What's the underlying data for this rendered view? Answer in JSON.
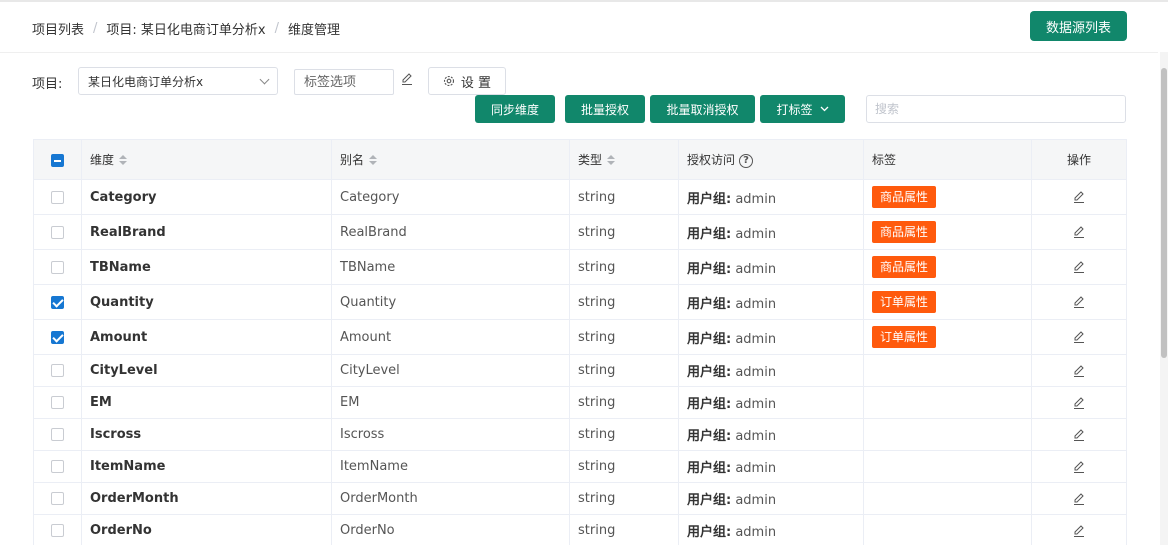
{
  "breadcrumb": {
    "items": [
      "项目列表",
      "项目: 某日化电商订单分析x",
      "维度管理"
    ],
    "separator": "/"
  },
  "header": {
    "datasource_button": "数据源列表"
  },
  "filters": {
    "project_label": "项目:",
    "project_value": "某日化电商订单分析x",
    "tag_placeholder": "标签选项",
    "settings_label": "设 置"
  },
  "toolbar": {
    "sync": "同步维度",
    "batch_grant": "批量授权",
    "batch_revoke": "批量取消授权",
    "tag": "打标签",
    "search_placeholder": "搜索"
  },
  "colors": {
    "primary": "#11876b",
    "tag": "#ff5a0d",
    "checkbox": "#1677d2"
  },
  "table": {
    "columns": {
      "dimension": "维度",
      "alias": "别名",
      "type": "类型",
      "access": "授权访问",
      "tag": "标签",
      "operation": "操作"
    },
    "header_checkbox": "indeterminate",
    "rows": [
      {
        "checked": false,
        "name": "Category",
        "alias": "Category",
        "type": "string",
        "access": "用户组: admin",
        "tag": "商品属性"
      },
      {
        "checked": false,
        "name": "RealBrand",
        "alias": "RealBrand",
        "type": "string",
        "access": "用户组: admin",
        "tag": "商品属性"
      },
      {
        "checked": false,
        "name": "TBName",
        "alias": "TBName",
        "type": "string",
        "access": "用户组: admin",
        "tag": "商品属性"
      },
      {
        "checked": true,
        "name": "Quantity",
        "alias": "Quantity",
        "type": "string",
        "access": "用户组: admin",
        "tag": "订单属性"
      },
      {
        "checked": true,
        "name": "Amount",
        "alias": "Amount",
        "type": "string",
        "access": "用户组: admin",
        "tag": "订单属性"
      },
      {
        "checked": false,
        "name": "CityLevel",
        "alias": "CityLevel",
        "type": "string",
        "access": "用户组: admin",
        "tag": ""
      },
      {
        "checked": false,
        "name": "EM",
        "alias": "EM",
        "type": "string",
        "access": "用户组: admin",
        "tag": ""
      },
      {
        "checked": false,
        "name": "Iscross",
        "alias": "Iscross",
        "type": "string",
        "access": "用户组: admin",
        "tag": ""
      },
      {
        "checked": false,
        "name": "ItemName",
        "alias": "ItemName",
        "type": "string",
        "access": "用户组: admin",
        "tag": ""
      },
      {
        "checked": false,
        "name": "OrderMonth",
        "alias": "OrderMonth",
        "type": "string",
        "access": "用户组: admin",
        "tag": ""
      },
      {
        "checked": false,
        "name": "OrderNo",
        "alias": "OrderNo",
        "type": "string",
        "access": "用户组: admin",
        "tag": ""
      }
    ]
  }
}
